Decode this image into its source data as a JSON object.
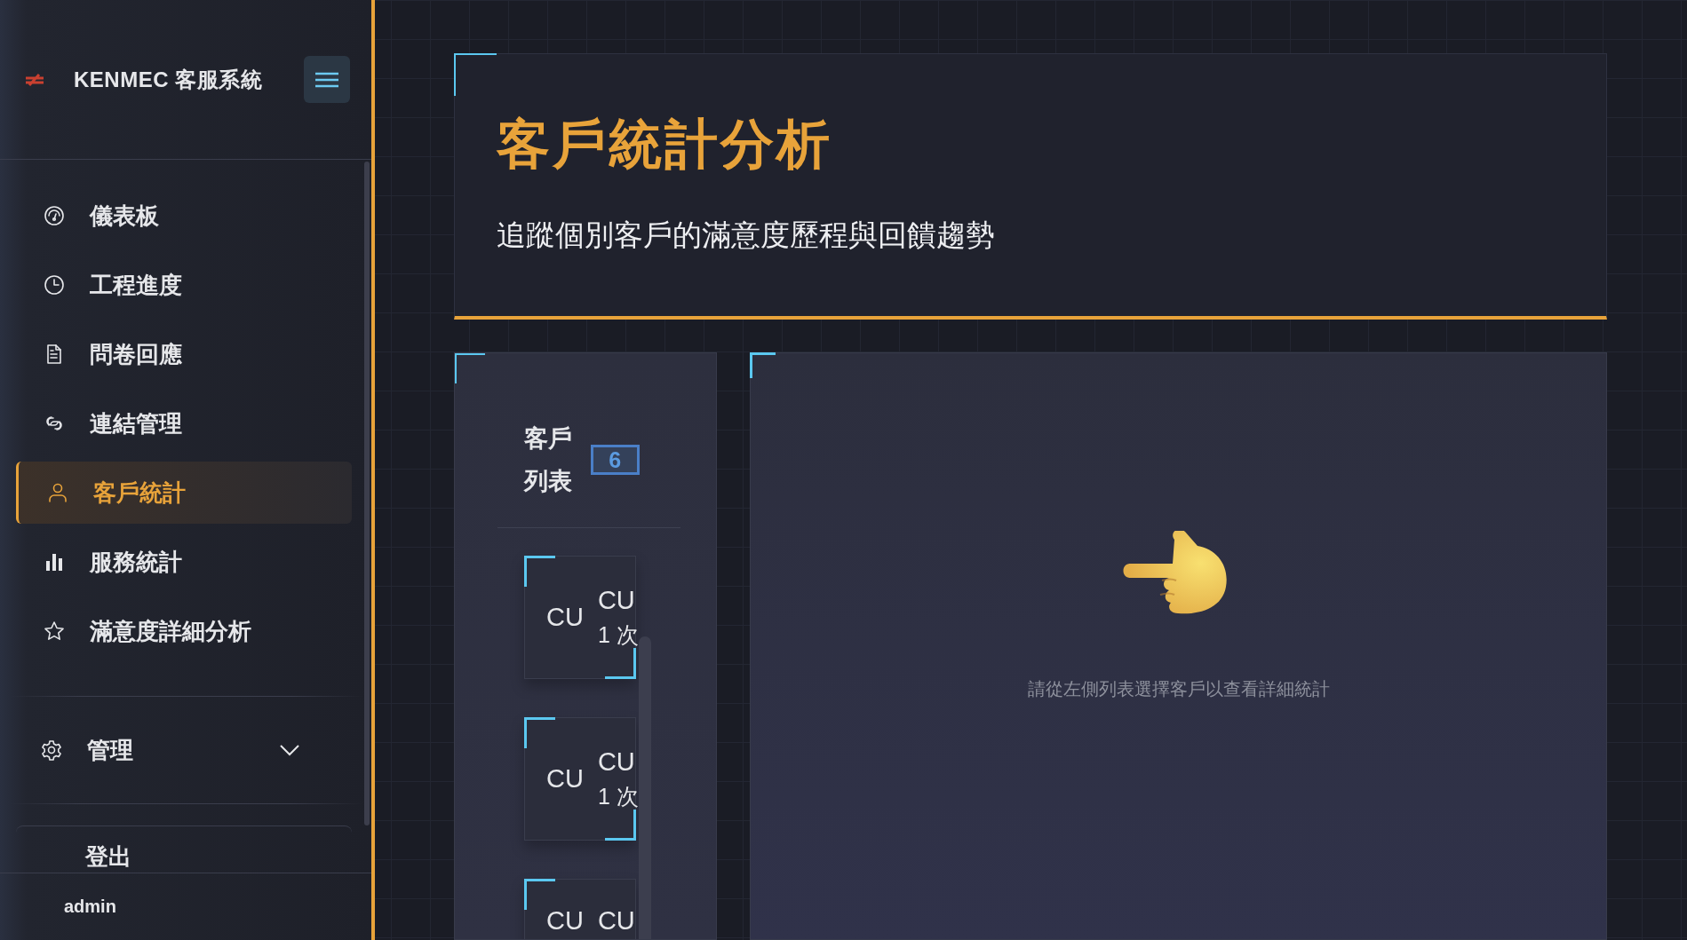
{
  "sidebar": {
    "brand": "KENMEC 客服系統",
    "nav_items": [
      {
        "label": "儀表板",
        "selected": false
      },
      {
        "label": "工程進度",
        "selected": false
      },
      {
        "label": "問卷回應",
        "selected": false
      },
      {
        "label": "連結管理",
        "selected": false
      },
      {
        "label": "客戶統計",
        "selected": true
      },
      {
        "label": "服務統計",
        "selected": false
      },
      {
        "label": "滿意度詳細分析",
        "selected": false
      }
    ],
    "admin_menu": {
      "label": "管理",
      "expanded": false
    },
    "logout": "登出",
    "user": "admin"
  },
  "header": {
    "title": "客戶統計分析",
    "subtitle": "追蹤個別客戶的滿意度歷程與回饋趨勢"
  },
  "customer_list": {
    "title": "客戶列表",
    "count": "6",
    "customers": [
      {
        "avatar": "CU",
        "name": "CU",
        "visits": "1 次"
      },
      {
        "avatar": "CU",
        "name": "CU",
        "visits": "1 次"
      },
      {
        "avatar": "CU",
        "name": "CU"
      }
    ]
  },
  "detail": {
    "message": "請從左側列表選擇客戶以查看詳細統計"
  }
}
